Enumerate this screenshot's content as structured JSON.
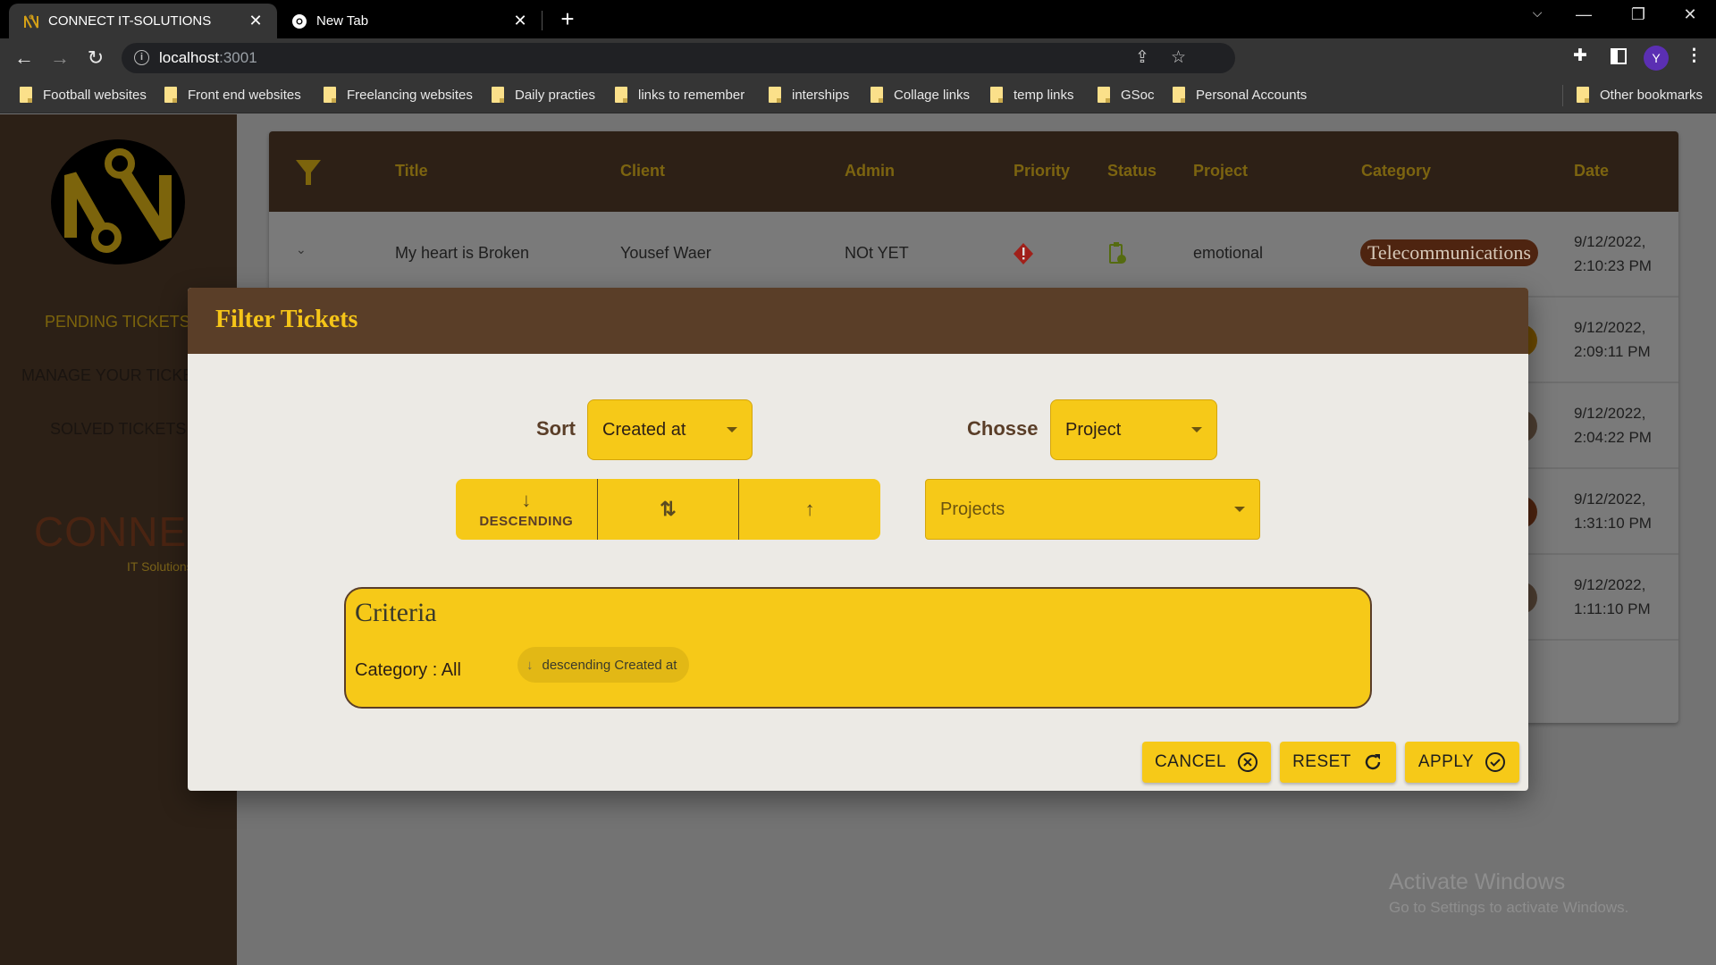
{
  "browser": {
    "tabs": [
      {
        "title": "CONNECT IT-SOLUTIONS",
        "active": true,
        "icon": "connect-logo-icon"
      },
      {
        "title": "New Tab",
        "active": false,
        "icon": "chrome-icon"
      }
    ],
    "url_host": "localhost",
    "url_port": ":3001",
    "profile_initial": "Y",
    "bookmarks": [
      "Football websites",
      "Front end websites",
      "Freelancing websites",
      "Daily practies",
      "links to remember",
      "interships",
      "Collage links",
      "temp links",
      "GSoc",
      "Personal Accounts"
    ],
    "other_bookmarks": "Other bookmarks"
  },
  "sidebar": {
    "nav": [
      {
        "label": "PENDING TICKETS",
        "active": true
      },
      {
        "label": "MANAGE YOUR TICKETS",
        "active": false
      },
      {
        "label": "SOLVED TICKETS",
        "active": false
      }
    ],
    "brand": "CONNECT",
    "brand_sub": "IT Solutions"
  },
  "table": {
    "columns": [
      "Title",
      "Client",
      "Admin",
      "Priority",
      "Status",
      "Project",
      "Category",
      "Date"
    ],
    "rows": [
      {
        "title": "My heart is Broken",
        "client": "Yousef Waer",
        "admin": "NOt YET",
        "priority": "high",
        "status": "pending",
        "project": "emotional",
        "category": "Telecommunications",
        "date": "9/12/2022,",
        "time": "2:10:23 PM"
      },
      {
        "date": "9/12/2022,",
        "time": "2:09:11 PM"
      },
      {
        "date": "9/12/2022,",
        "time": "2:04:22 PM"
      },
      {
        "date": "9/12/2022,",
        "time": "1:31:10 PM"
      },
      {
        "date": "9/12/2022,",
        "time": "1:11:10 PM"
      }
    ]
  },
  "dialog": {
    "title": "Filter Tickets",
    "sort_label": "Sort",
    "sort_value": "Created at",
    "choose_label": "Chosse",
    "choose_value": "Project",
    "projects_placeholder": "Projects",
    "order_buttons": [
      {
        "label": "DESCENDING",
        "icon": "arrow-down-icon",
        "selected": true
      },
      {
        "label": "",
        "icon": "swap-vertical-icon",
        "selected": false
      },
      {
        "label": "",
        "icon": "arrow-up-icon",
        "selected": false
      }
    ],
    "criteria": {
      "title": "Criteria",
      "category_text": "Category : All",
      "chip": "descending Created at"
    },
    "buttons": {
      "cancel": "CANCEL",
      "reset": "RESET",
      "apply": "APPLY"
    }
  },
  "watermark": {
    "line1": "Activate Windows",
    "line2": "Go to Settings to activate Windows."
  },
  "colors": {
    "accent": "#f6c918",
    "brown": "#5a3e28",
    "dark": "#2d2016"
  }
}
